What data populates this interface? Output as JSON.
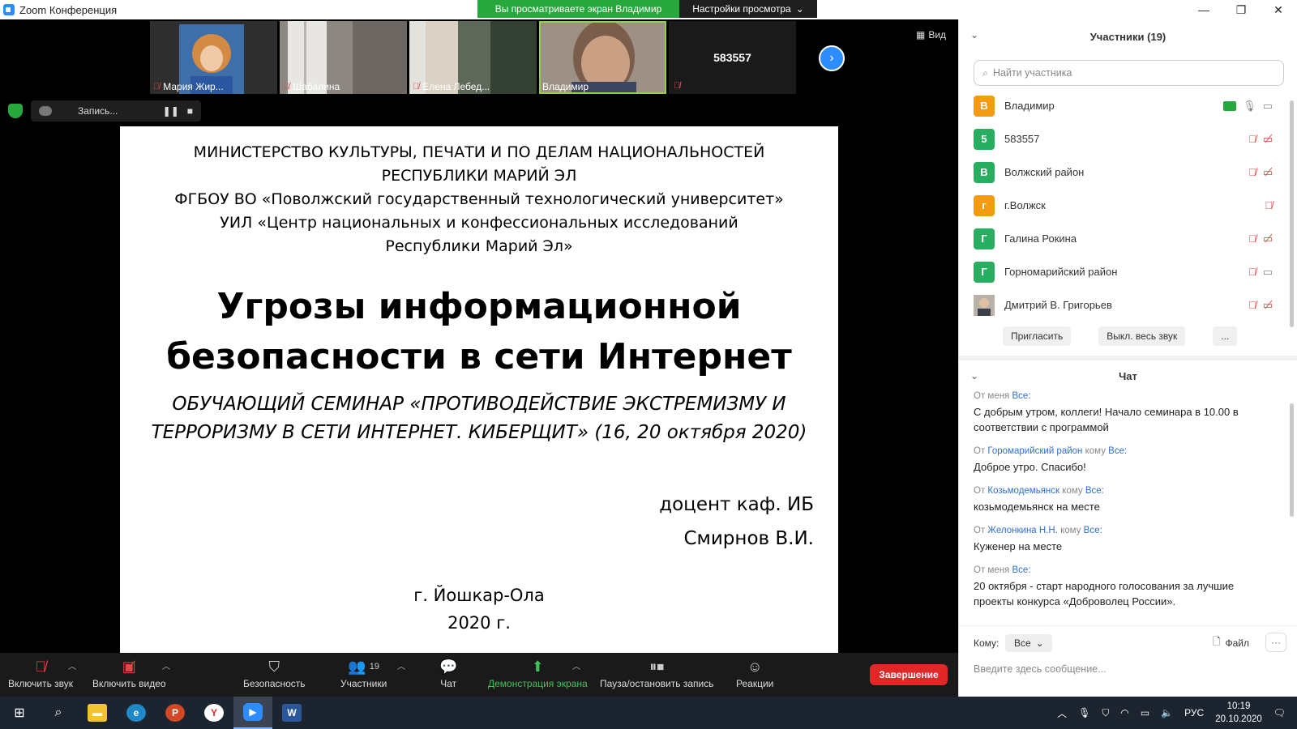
{
  "titlebar": {
    "title": "Zoom Конференция",
    "banner": "Вы просматриваете экран Владимир",
    "view_settings": "Настройки просмотра",
    "minimize": "—",
    "restore": "❐",
    "close": "✕"
  },
  "thumbnails": [
    {
      "name": "Мария Жир...",
      "muted": true,
      "bg": "#9a7a5a"
    },
    {
      "name": "Шабалина",
      "muted": true,
      "bg": "#9d9891"
    },
    {
      "name": "Елена Лебед...",
      "muted": true,
      "bg": "#6f7a6a"
    },
    {
      "name": "Владимир",
      "muted": false,
      "bg": "#5a5048"
    }
  ],
  "number_tile": "583557",
  "view_button": "Вид",
  "recording": {
    "label": "Запись...",
    "pause": "❚❚",
    "stop": "■"
  },
  "slide": {
    "org_lines": [
      "МИНИСТЕРСТВО КУЛЬТУРЫ, ПЕЧАТИ И ПО ДЕЛАМ НАЦИОНАЛЬНОСТЕЙ",
      "РЕСПУБЛИКИ МАРИЙ ЭЛ",
      "ФГБОУ ВО «Поволжский государственный технологический университет»",
      "УИЛ «Центр национальных и конфессиональных исследований",
      "Республики Марий Эл»"
    ],
    "headline_1": "Угрозы информационной",
    "headline_2": "безопасности в сети Интернет",
    "seminar_1": "ОБУЧАЮЩИЙ СЕМИНАР «ПРОТИВОДЕЙСТВИЕ ЭКСТРЕМИЗМУ И",
    "seminar_2": "ТЕРРОРИЗМУ В СЕТИ ИНТЕРНЕТ. КИБЕРЩИТ» (16, 20 октября 2020)",
    "author_1": "доцент каф. ИБ",
    "author_2": "Смирнов В.И.",
    "city": "г. Йошкар-Ола",
    "year": "2020 г."
  },
  "toolbar": {
    "audio": "Включить звук",
    "video": "Включить видео",
    "security": "Безопасность",
    "participants": "Участники",
    "participants_count": "19",
    "chat": "Чат",
    "share": "Демонстрация экрана",
    "record": "Пауза/остановить запись",
    "reactions": "Реакции",
    "end": "Завершение"
  },
  "participants_panel": {
    "title": "Участники (19)",
    "search_placeholder": "Найти участника",
    "items": [
      {
        "initial": "В",
        "name": "Владимир",
        "color": "#f39c12"
      },
      {
        "initial": "5",
        "name": "583557",
        "color": "#27ae60"
      },
      {
        "initial": "В",
        "name": "Волжский район",
        "color": "#27ae60"
      },
      {
        "initial": "г",
        "name": "г.Волжск",
        "color": "#f39c12"
      },
      {
        "initial": "Г",
        "name": "Галина Рокина",
        "color": "#27ae60"
      },
      {
        "initial": "Г",
        "name": "Горномарийский район",
        "color": "#27ae60"
      },
      {
        "initial": "",
        "name": "Дмитрий В. Григорьев",
        "color": "#8a8a8a"
      }
    ],
    "invite": "Пригласить",
    "mute_all": "Выкл. весь звук",
    "more": "..."
  },
  "chat": {
    "title": "Чат",
    "messages": [
      {
        "from": "От меня",
        "sender": "",
        "to_word": "",
        "to": "Все:",
        "text": "С добрым утром, коллеги! Начало семинара в 10.00 в соответствии с программой"
      },
      {
        "from": "От",
        "sender": "Горомарийский район",
        "to_word": "кому",
        "to": "Все:",
        "text": "Доброе утро. Спасибо!"
      },
      {
        "from": "От",
        "sender": "Козьмодемьянск",
        "to_word": "кому",
        "to": "Все:",
        "text": "козьмодемьянск на месте"
      },
      {
        "from": "От",
        "sender": "Желонкина Н.Н.",
        "to_word": "кому",
        "to": "Все:",
        "text": "Куженер на месте"
      },
      {
        "from": "От меня",
        "sender": "",
        "to_word": "",
        "to": "Все:",
        "text": "20 октября - старт народного голосования за лучшие проекты конкурса «Доброволец России»."
      }
    ],
    "to_label": "Кому:",
    "to_value": "Все",
    "file": "Файл",
    "input_placeholder": "Введите здесь сообщение..."
  },
  "taskbar": {
    "lang": "РУС",
    "time": "10:19",
    "date": "20.10.2020"
  }
}
